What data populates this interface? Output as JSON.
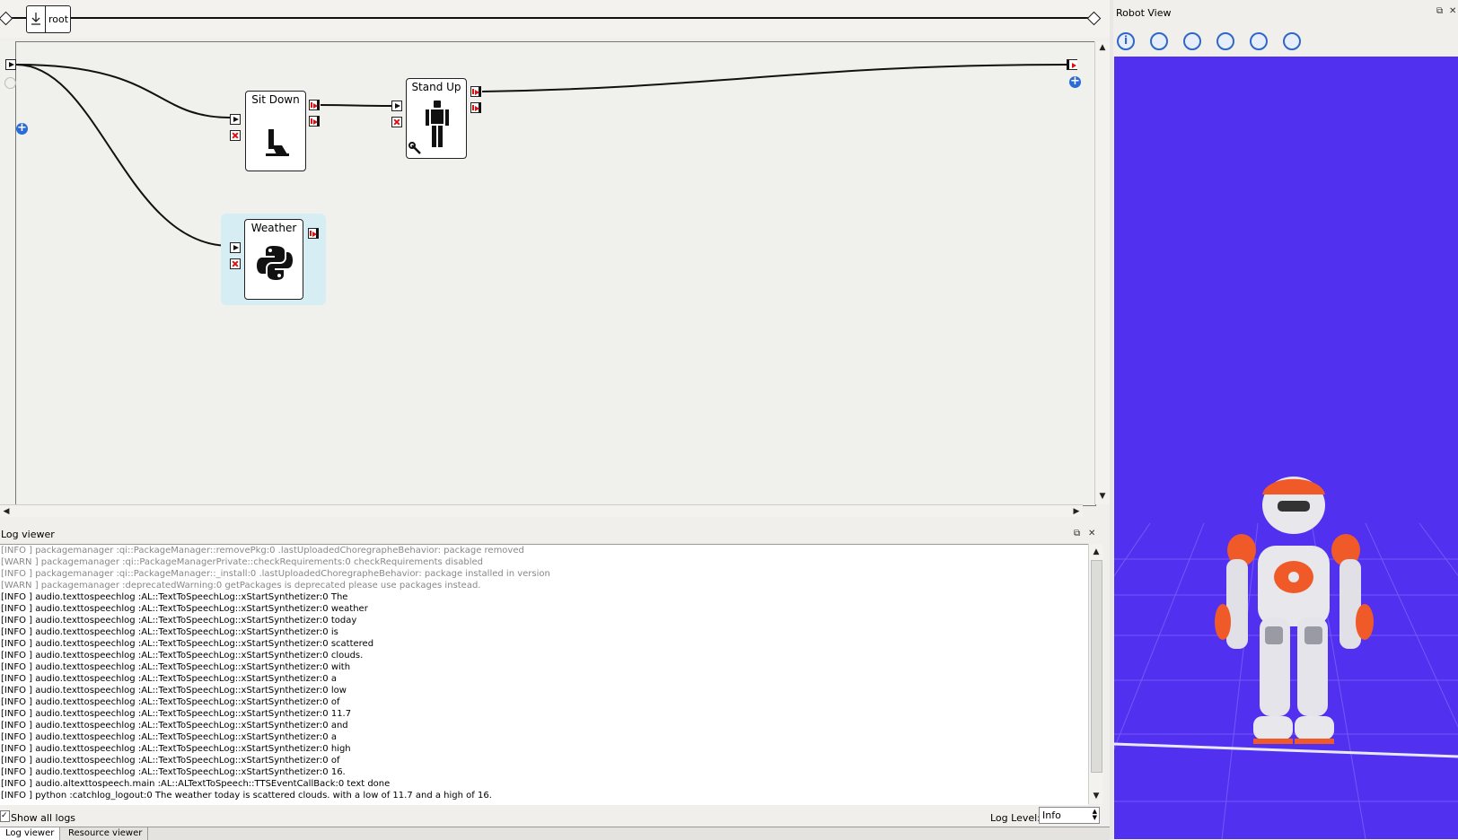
{
  "breadcrumb": {
    "root_label": "root"
  },
  "diagram": {
    "boxes": [
      {
        "name": "sit-down",
        "label": "Sit Down"
      },
      {
        "name": "stand-up",
        "label": "Stand Up"
      },
      {
        "name": "weather",
        "label": "Weather"
      }
    ]
  },
  "log_viewer": {
    "title": "Log viewer",
    "lines": [
      "[INFO ] packagemanager :qi::PackageManager::removePkg:0 .lastUploadedChoregrapheBehavior: package removed",
      "[WARN ] packagemanager :qi::PackageManagerPrivate::checkRequirements:0 checkRequirements disabled",
      "[INFO ] packagemanager :qi::PackageManager::_install:0 .lastUploadedChoregrapheBehavior: package installed in version",
      "[WARN ] packagemanager :deprecatedWarning:0 getPackages is deprecated please use packages instead.",
      "[INFO ] audio.texttospeechlog :AL::TextToSpeechLog::xStartSynthetizer:0 The",
      "[INFO ] audio.texttospeechlog :AL::TextToSpeechLog::xStartSynthetizer:0 weather",
      "[INFO ] audio.texttospeechlog :AL::TextToSpeechLog::xStartSynthetizer:0 today",
      "[INFO ] audio.texttospeechlog :AL::TextToSpeechLog::xStartSynthetizer:0 is",
      "[INFO ] audio.texttospeechlog :AL::TextToSpeechLog::xStartSynthetizer:0 scattered",
      "[INFO ] audio.texttospeechlog :AL::TextToSpeechLog::xStartSynthetizer:0 clouds.",
      "[INFO ] audio.texttospeechlog :AL::TextToSpeechLog::xStartSynthetizer:0 with",
      "[INFO ] audio.texttospeechlog :AL::TextToSpeechLog::xStartSynthetizer:0 a",
      "[INFO ] audio.texttospeechlog :AL::TextToSpeechLog::xStartSynthetizer:0 low",
      "[INFO ] audio.texttospeechlog :AL::TextToSpeechLog::xStartSynthetizer:0 of",
      "[INFO ] audio.texttospeechlog :AL::TextToSpeechLog::xStartSynthetizer:0 11.7",
      "[INFO ] audio.texttospeechlog :AL::TextToSpeechLog::xStartSynthetizer:0 and",
      "[INFO ] audio.texttospeechlog :AL::TextToSpeechLog::xStartSynthetizer:0 a",
      "[INFO ] audio.texttospeechlog :AL::TextToSpeechLog::xStartSynthetizer:0 high",
      "[INFO ] audio.texttospeechlog :AL::TextToSpeechLog::xStartSynthetizer:0 of",
      "[INFO ] audio.texttospeechlog :AL::TextToSpeechLog::xStartSynthetizer:0 16.",
      "[INFO ] audio.altexttospeech.main :AL::ALTextToSpeech::TTSEventCallBack:0 text done",
      "[INFO ] python :catchlog_logout:0 The weather today is scattered clouds. with a low of 11.7 and a high of 16."
    ],
    "show_all_label": "Show all logs",
    "log_level_label": "Log Level:",
    "log_level_value": "Info",
    "tabs": [
      "Log viewer",
      "Resource viewer"
    ]
  },
  "robot_view": {
    "title": "Robot View",
    "toolbar_icons": [
      "info-icon",
      "robot-view-icon-1",
      "robot-view-icon-2",
      "robot-view-icon-3",
      "robot-view-icon-4",
      "robot-view-icon-5"
    ],
    "background_color": "#5230f0",
    "robot_accent_color": "#f05a28"
  }
}
